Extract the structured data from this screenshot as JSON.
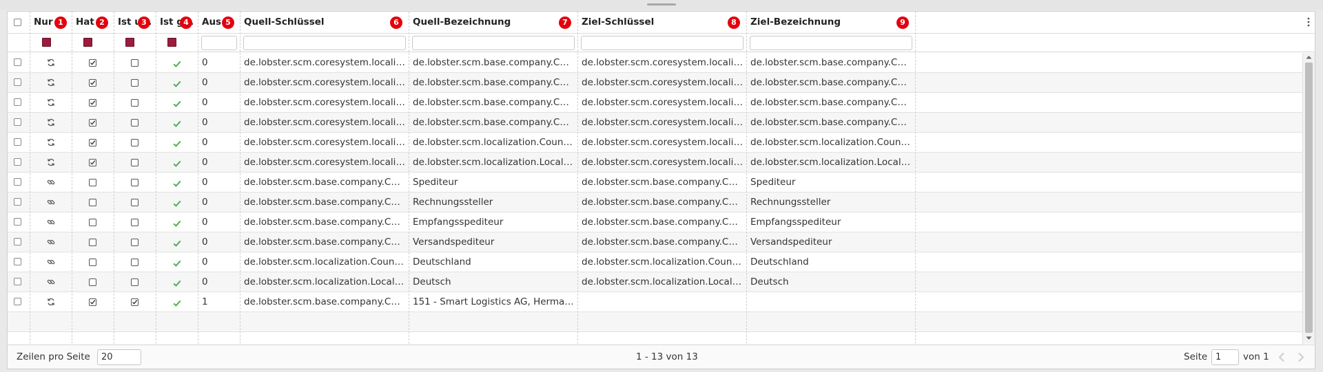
{
  "columns": [
    {
      "label": "Nur ...",
      "badge": "1"
    },
    {
      "label": "Hat ...",
      "badge": "2"
    },
    {
      "label": "Ist u...",
      "badge": "3"
    },
    {
      "label": "Ist g...",
      "badge": "4"
    },
    {
      "label": "Aus...",
      "badge": "5"
    },
    {
      "label": "Quell-Schlüssel",
      "badge": "6"
    },
    {
      "label": "Quell-Bezeichnung",
      "badge": "7"
    },
    {
      "label": "Ziel-Schlüssel",
      "badge": "8"
    },
    {
      "label": "Ziel-Bezeichnung",
      "badge": "9"
    }
  ],
  "rows": [
    {
      "nur": "sync-icon",
      "hat": true,
      "ist_u": false,
      "ist_g": true,
      "aus": "0",
      "qs": "de.lobster.scm.coresystem.localization.d...",
      "qb": "de.lobster.scm.base.company.CompanyT...",
      "zs": "de.lobster.scm.coresystem.localization.d...",
      "zb": "de.lobster.scm.base.company.CompanyT..."
    },
    {
      "nur": "sync-icon",
      "hat": true,
      "ist_u": false,
      "ist_g": true,
      "aus": "0",
      "qs": "de.lobster.scm.coresystem.localization.d...",
      "qb": "de.lobster.scm.base.company.CompanyT...",
      "zs": "de.lobster.scm.coresystem.localization.d...",
      "zb": "de.lobster.scm.base.company.CompanyT..."
    },
    {
      "nur": "sync-icon",
      "hat": true,
      "ist_u": false,
      "ist_g": true,
      "aus": "0",
      "qs": "de.lobster.scm.coresystem.localization.d...",
      "qb": "de.lobster.scm.base.company.CompanyT...",
      "zs": "de.lobster.scm.coresystem.localization.d...",
      "zb": "de.lobster.scm.base.company.CompanyT..."
    },
    {
      "nur": "sync-icon",
      "hat": true,
      "ist_u": false,
      "ist_g": true,
      "aus": "0",
      "qs": "de.lobster.scm.coresystem.localization.d...",
      "qb": "de.lobster.scm.base.company.CompanyT...",
      "zs": "de.lobster.scm.coresystem.localization.d...",
      "zb": "de.lobster.scm.base.company.CompanyT..."
    },
    {
      "nur": "sync-icon",
      "hat": true,
      "ist_u": false,
      "ist_g": true,
      "aus": "0",
      "qs": "de.lobster.scm.coresystem.localization.d...",
      "qb": "de.lobster.scm.localization.Country:DE",
      "zs": "de.lobster.scm.coresystem.localization.d...",
      "zb": "de.lobster.scm.localization.Country:DE"
    },
    {
      "nur": "sync-icon",
      "hat": true,
      "ist_u": false,
      "ist_g": true,
      "aus": "0",
      "qs": "de.lobster.scm.coresystem.localization.d...",
      "qb": "de.lobster.scm.localization.Locale:de",
      "zs": "de.lobster.scm.coresystem.localization.d...",
      "zb": "de.lobster.scm.localization.Locale:de"
    },
    {
      "nur": "link-icon",
      "hat": false,
      "ist_u": false,
      "ist_g": true,
      "aus": "0",
      "qs": "de.lobster.scm.base.company.CompanyT...",
      "qb": "Spediteur",
      "zs": "de.lobster.scm.base.company.CompanyT...",
      "zb": "Spediteur"
    },
    {
      "nur": "link-icon",
      "hat": false,
      "ist_u": false,
      "ist_g": true,
      "aus": "0",
      "qs": "de.lobster.scm.base.company.CompanyT...",
      "qb": "Rechnungssteller",
      "zs": "de.lobster.scm.base.company.CompanyT...",
      "zb": "Rechnungssteller"
    },
    {
      "nur": "link-icon",
      "hat": false,
      "ist_u": false,
      "ist_g": true,
      "aus": "0",
      "qs": "de.lobster.scm.base.company.CompanyT...",
      "qb": "Empfangsspediteur",
      "zs": "de.lobster.scm.base.company.CompanyT...",
      "zb": "Empfangsspediteur"
    },
    {
      "nur": "link-icon",
      "hat": false,
      "ist_u": false,
      "ist_g": true,
      "aus": "0",
      "qs": "de.lobster.scm.base.company.CompanyT...",
      "qb": "Versandspediteur",
      "zs": "de.lobster.scm.base.company.CompanyT...",
      "zb": "Versandspediteur"
    },
    {
      "nur": "link-icon",
      "hat": false,
      "ist_u": false,
      "ist_g": true,
      "aus": "0",
      "qs": "de.lobster.scm.localization.Country#DE",
      "qb": "Deutschland",
      "zs": "de.lobster.scm.localization.Country#DE",
      "zb": "Deutschland"
    },
    {
      "nur": "link-icon",
      "hat": false,
      "ist_u": false,
      "ist_g": true,
      "aus": "0",
      "qs": "de.lobster.scm.localization.Locale#de",
      "qb": "Deutsch",
      "zs": "de.lobster.scm.localization.Locale#de",
      "zb": "Deutsch"
    },
    {
      "nur": "sync-icon",
      "hat": true,
      "ist_u": true,
      "ist_g": true,
      "aus": "1",
      "qs": "de.lobster.scm.base.company.Company...",
      "qb": "151 - Smart Logistics AG, Hermannstrasse...",
      "zs": "",
      "zb": ""
    }
  ],
  "footer": {
    "rows_per_page_label": "Zeilen pro Seite",
    "rows_per_page_value": "20",
    "range": "1 - 13 von 13",
    "page_label": "Seite",
    "page_value": "1",
    "page_of": "von 1"
  },
  "colors": {
    "filter_box": "#9b1c3c",
    "badge": "#e3000f",
    "check_green": "#4caf50"
  }
}
